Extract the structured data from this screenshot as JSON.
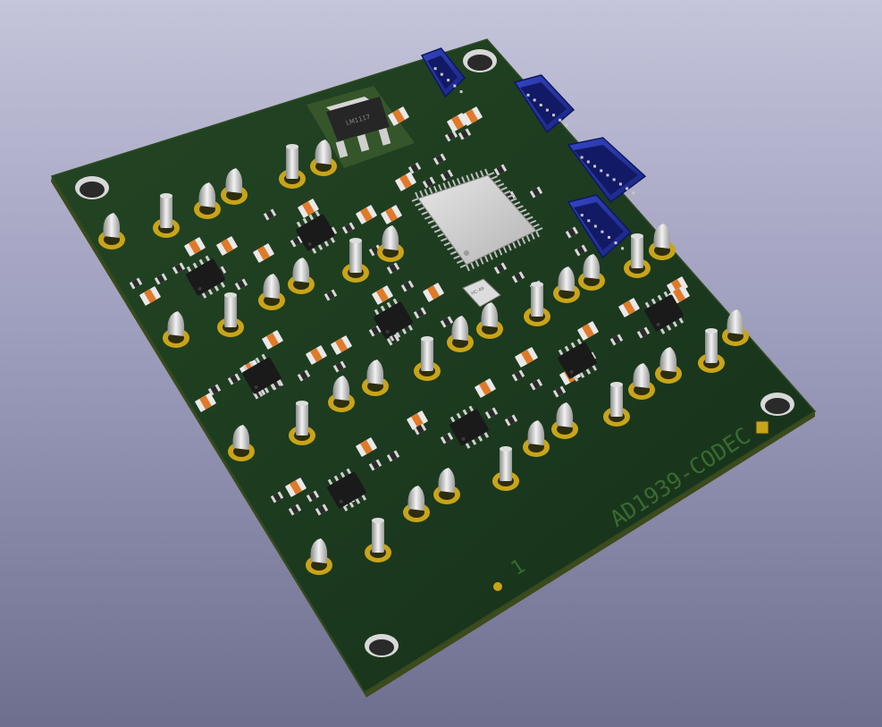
{
  "scene": {
    "background_top": "#c4c4da",
    "background_bottom": "#6e6e8e",
    "board_color": "#1d3a1d",
    "board_edge_color": "#3d4a1a",
    "silkscreen_color": "#3a6a30",
    "connector_color": "#1f2f9a",
    "gold_color": "#c8a418",
    "component_color": "#1a1a1a"
  },
  "board": {
    "silkscreen_label": "AD1939-CODEC",
    "pin_one_marker": "1"
  },
  "regulator": {
    "marking": "LM1117"
  },
  "codec_chip": {
    "type": "LQFP-64",
    "color": "#c8c8c8"
  },
  "crystal": {
    "marking": "HC-49"
  }
}
